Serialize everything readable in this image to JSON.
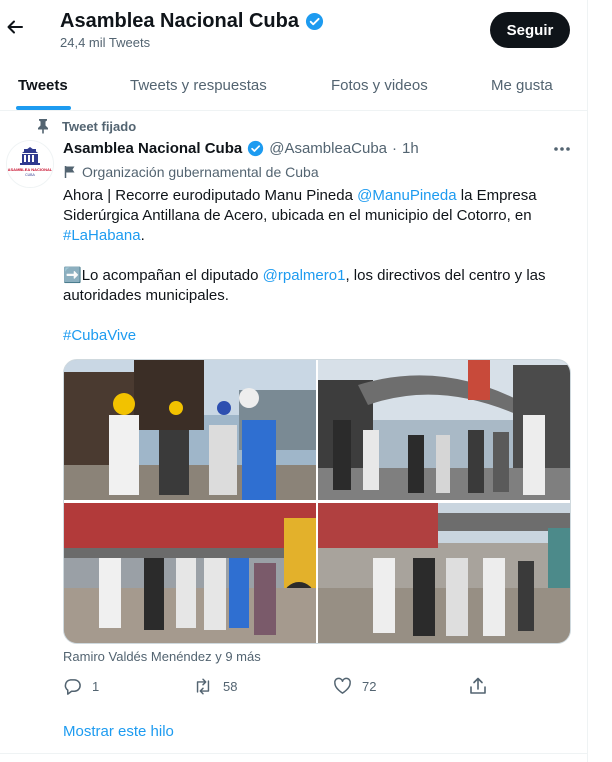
{
  "header": {
    "title": "Asamblea Nacional Cuba",
    "subtitle": "24,4 mil Tweets",
    "follow_label": "Seguir"
  },
  "tabs": [
    {
      "label": "Tweets",
      "active": true
    },
    {
      "label": "Tweets y respuestas",
      "active": false
    },
    {
      "label": "Fotos y videos",
      "active": false
    },
    {
      "label": "Me gusta",
      "active": false
    }
  ],
  "tweet": {
    "pinned_label": "Tweet fijado",
    "author_name": "Asamblea Nacional Cuba",
    "handle": "@AsambleaCuba",
    "separator": "·",
    "time": "1h",
    "org_label": "Organización gubernamental de Cuba",
    "avatar_lines": [
      "ASAMBLEA NACIONAL",
      "CUBA"
    ],
    "text": {
      "p1_a": "Ahora | Recorre eurodiputado Manu Pineda ",
      "p1_mention": "@ManuPineda",
      "p1_b": " la Empresa Siderúrgica Antillana de Acero, ubicada en el municipio del Cotorro, en ",
      "p1_hashtag": "#LaHabana",
      "p1_c": ".",
      "p2_emoji": "➡️",
      "p2_a": "Lo acompañan el diputado ",
      "p2_mention": "@rpalmero1",
      "p2_b": ", los directivos del centro y las autoridades municipales.",
      "p3_hashtag": "#CubaVive"
    },
    "tagged": "Ramiro Valdés Menéndez y 9 más",
    "actions": {
      "reply_count": "1",
      "retweet_count": "58",
      "like_count": "72"
    },
    "show_thread": "Mostrar este hilo"
  },
  "colors": {
    "accent": "#1d9bf0",
    "text": "#0f1419",
    "muted": "#536471"
  },
  "icons": [
    "back-arrow-icon",
    "verified-badge-icon",
    "pin-icon",
    "more-icon",
    "flag-icon",
    "reply-icon",
    "retweet-icon",
    "like-icon",
    "share-icon"
  ]
}
